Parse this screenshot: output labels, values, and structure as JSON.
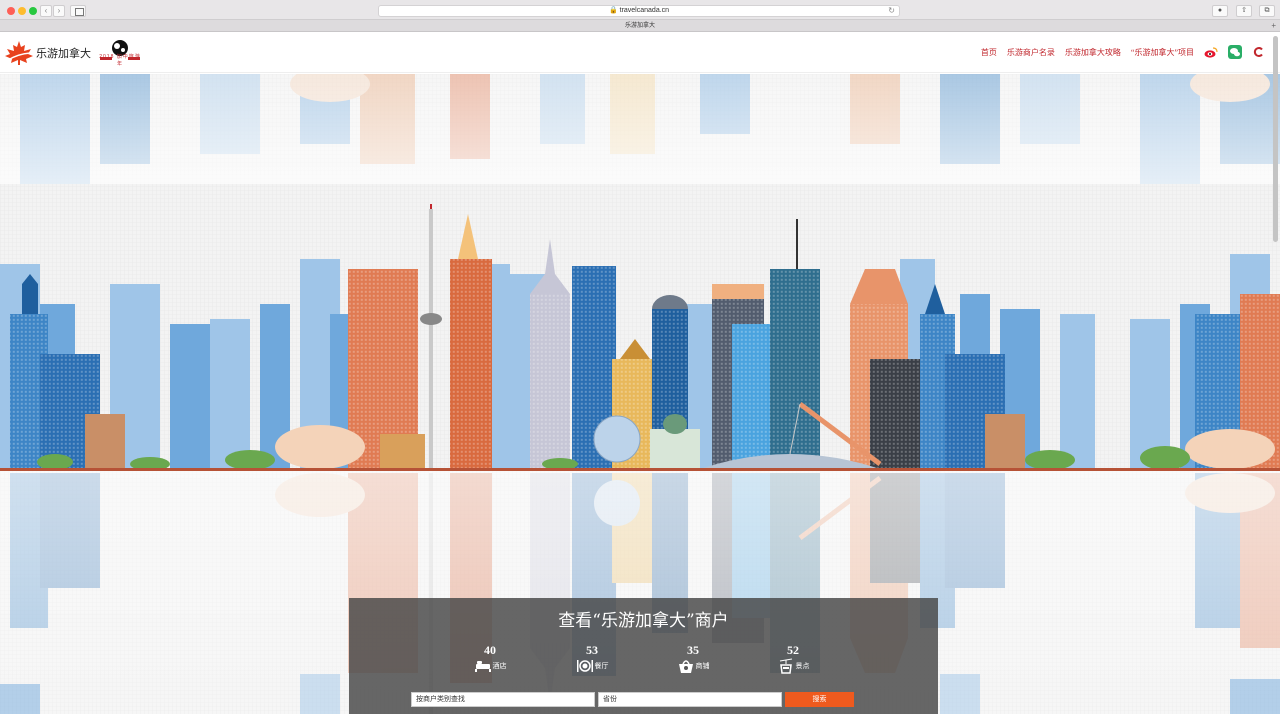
{
  "browser": {
    "url": "travelcanada.cn",
    "tab_title": "乐游加拿大"
  },
  "header": {
    "logo_text": "乐游加拿大",
    "logo2018_text": "2018 加中旅游年",
    "nav": [
      {
        "label": "首页"
      },
      {
        "label": "乐游商户名录"
      },
      {
        "label": "乐游加拿大攻略"
      },
      {
        "label": "“乐游加拿大”项目"
      }
    ],
    "icons": [
      "weibo-icon",
      "wechat-icon",
      "c-icon"
    ]
  },
  "panel": {
    "title": "查看“乐游加拿大”商户",
    "stats": [
      {
        "count": "40",
        "label": "酒店",
        "icon": "hotel-icon"
      },
      {
        "count": "53",
        "label": "餐厅",
        "icon": "restaurant-icon"
      },
      {
        "count": "35",
        "label": "商铺",
        "icon": "shop-icon"
      },
      {
        "count": "52",
        "label": "景点",
        "icon": "attraction-icon"
      }
    ],
    "category_placeholder": "按商户类别查找",
    "province_placeholder": "省份",
    "search_label": "搜索"
  },
  "colors": {
    "brand_red": "#c1272d",
    "search_orange": "#ef5a1e"
  }
}
